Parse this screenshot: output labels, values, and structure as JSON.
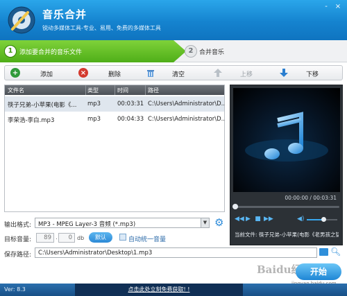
{
  "app": {
    "title": "音乐合并",
    "subtitle": "锐动多媒体工具-专业、易用、免费的多媒体工具"
  },
  "window_controls": [
    "-",
    "×"
  ],
  "steps": [
    {
      "num": "1",
      "label": "添加要合并的音乐文件",
      "active": true
    },
    {
      "num": "2",
      "label": "合并音乐",
      "active": false
    }
  ],
  "toolbar": {
    "add": "添加",
    "delete": "删除",
    "clear": "清空",
    "move_up": "上移",
    "move_down": "下移"
  },
  "table": {
    "columns": [
      "文件名",
      "类型",
      "时间",
      "路径"
    ],
    "rows": [
      {
        "name": "筷子兄弟-小苹果(电影《...",
        "type": "mp3",
        "time": "00:03:31",
        "path": "C:\\Users\\Administrator\\D..."
      },
      {
        "name": "李荣浩-李白.mp3",
        "type": "mp3",
        "time": "00:04:33",
        "path": "C:\\Users\\Administrator\\D..."
      }
    ]
  },
  "player": {
    "time": "00:00:00 / 00:03:31",
    "progress": 0.0,
    "volume": 0.55,
    "now_playing": "当前文件: 筷子兄弟-小苹果(电影《老男孩之猛"
  },
  "form": {
    "format_label": "输出格式:",
    "format_value": "MP3 - MPEG Layer-3 音频 (*.mp3)",
    "volume_label": "目标音量:",
    "volume_int": "89",
    "volume_dec": "0",
    "volume_unit": "db",
    "default_btn": "默认",
    "auto_label": "自动统一音量",
    "path_label": "保存路径:",
    "path_value": "C:\\Users\\Administrator\\Desktop\\1.mp3"
  },
  "start_button": "开始",
  "watermark": "Baidu经验",
  "watermark_url": "jingyan.baidu.com",
  "status": {
    "version": "Ver: 8.3",
    "promo": "点击此处立刻免费获取! !"
  },
  "colors": {
    "titlebar": "#1583cf",
    "step_active": "#4fae18",
    "accent": "#2b89d6"
  }
}
